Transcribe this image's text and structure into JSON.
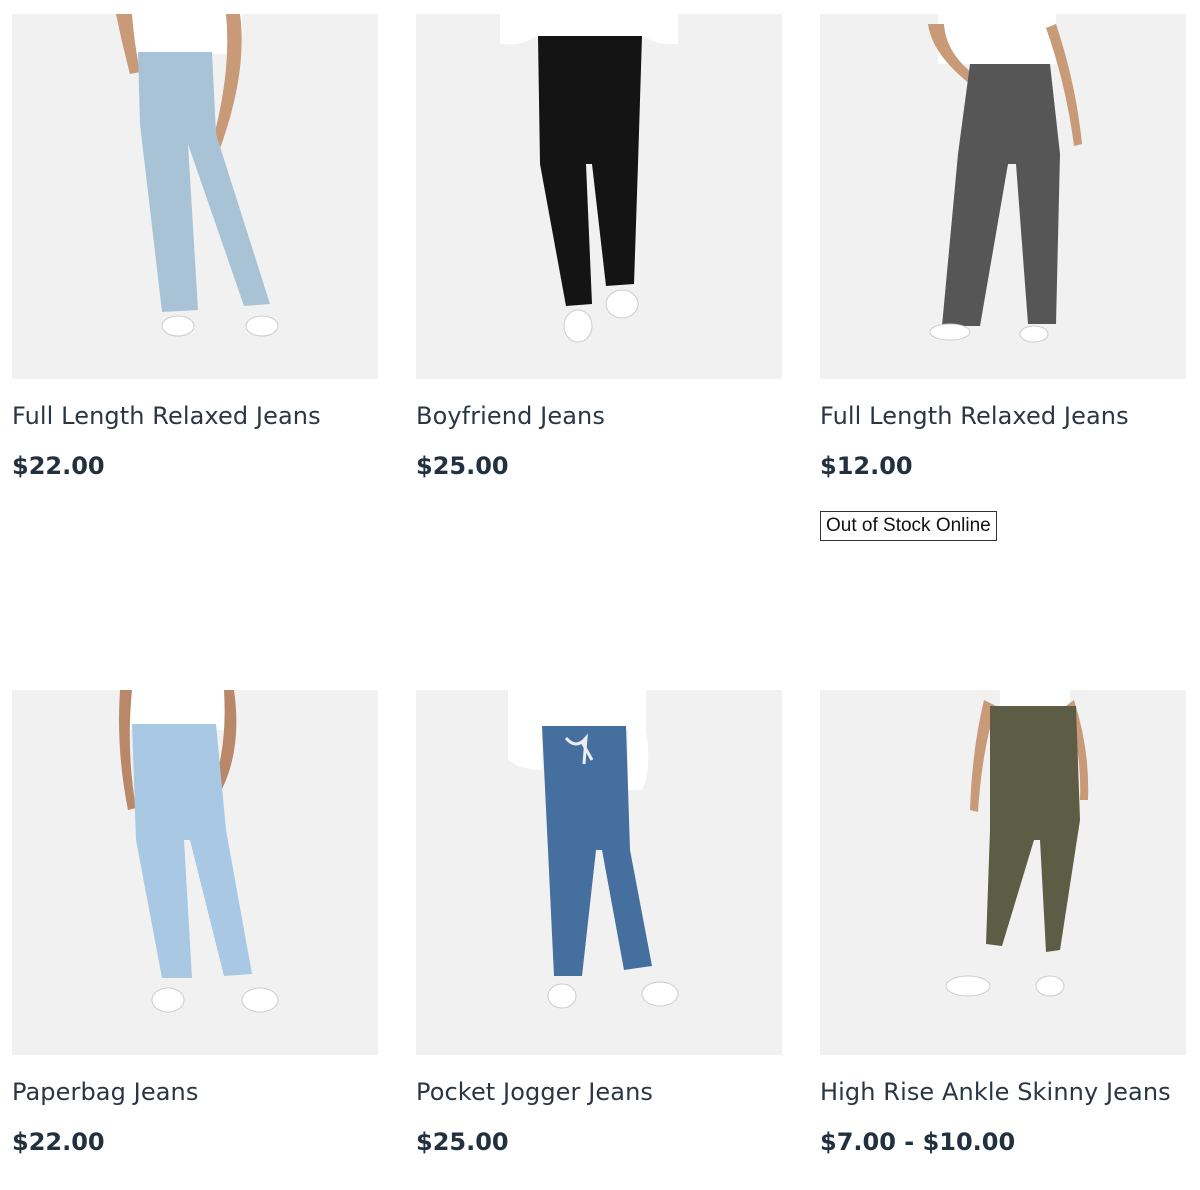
{
  "products": [
    {
      "name": "Full Length Relaxed Jeans",
      "price": "$22.00",
      "color": "#a9c3d6",
      "image_icon": "model-wearing-light-blue-relaxed-jeans"
    },
    {
      "name": "Boyfriend Jeans",
      "price": "$25.00",
      "color": "#141414",
      "image_icon": "model-wearing-black-boyfriend-jeans"
    },
    {
      "name": "Full Length Relaxed Jeans",
      "price": "$12.00",
      "badge": "Out of Stock Online",
      "color": "#565656",
      "image_icon": "model-wearing-grey-relaxed-jeans"
    },
    {
      "name": "Paperbag Jeans",
      "price": "$22.00",
      "color": "#a8c8e4",
      "image_icon": "model-wearing-light-blue-paperbag-jeans"
    },
    {
      "name": "Pocket Jogger Jeans",
      "price": "$25.00",
      "color": "#456f9e",
      "image_icon": "model-wearing-mid-blue-jogger-jeans"
    },
    {
      "name": "High Rise Ankle Skinny Jeans",
      "price": "$7.00 - $10.00",
      "color": "#5d5c45",
      "image_icon": "model-wearing-khaki-skinny-jeans"
    }
  ]
}
